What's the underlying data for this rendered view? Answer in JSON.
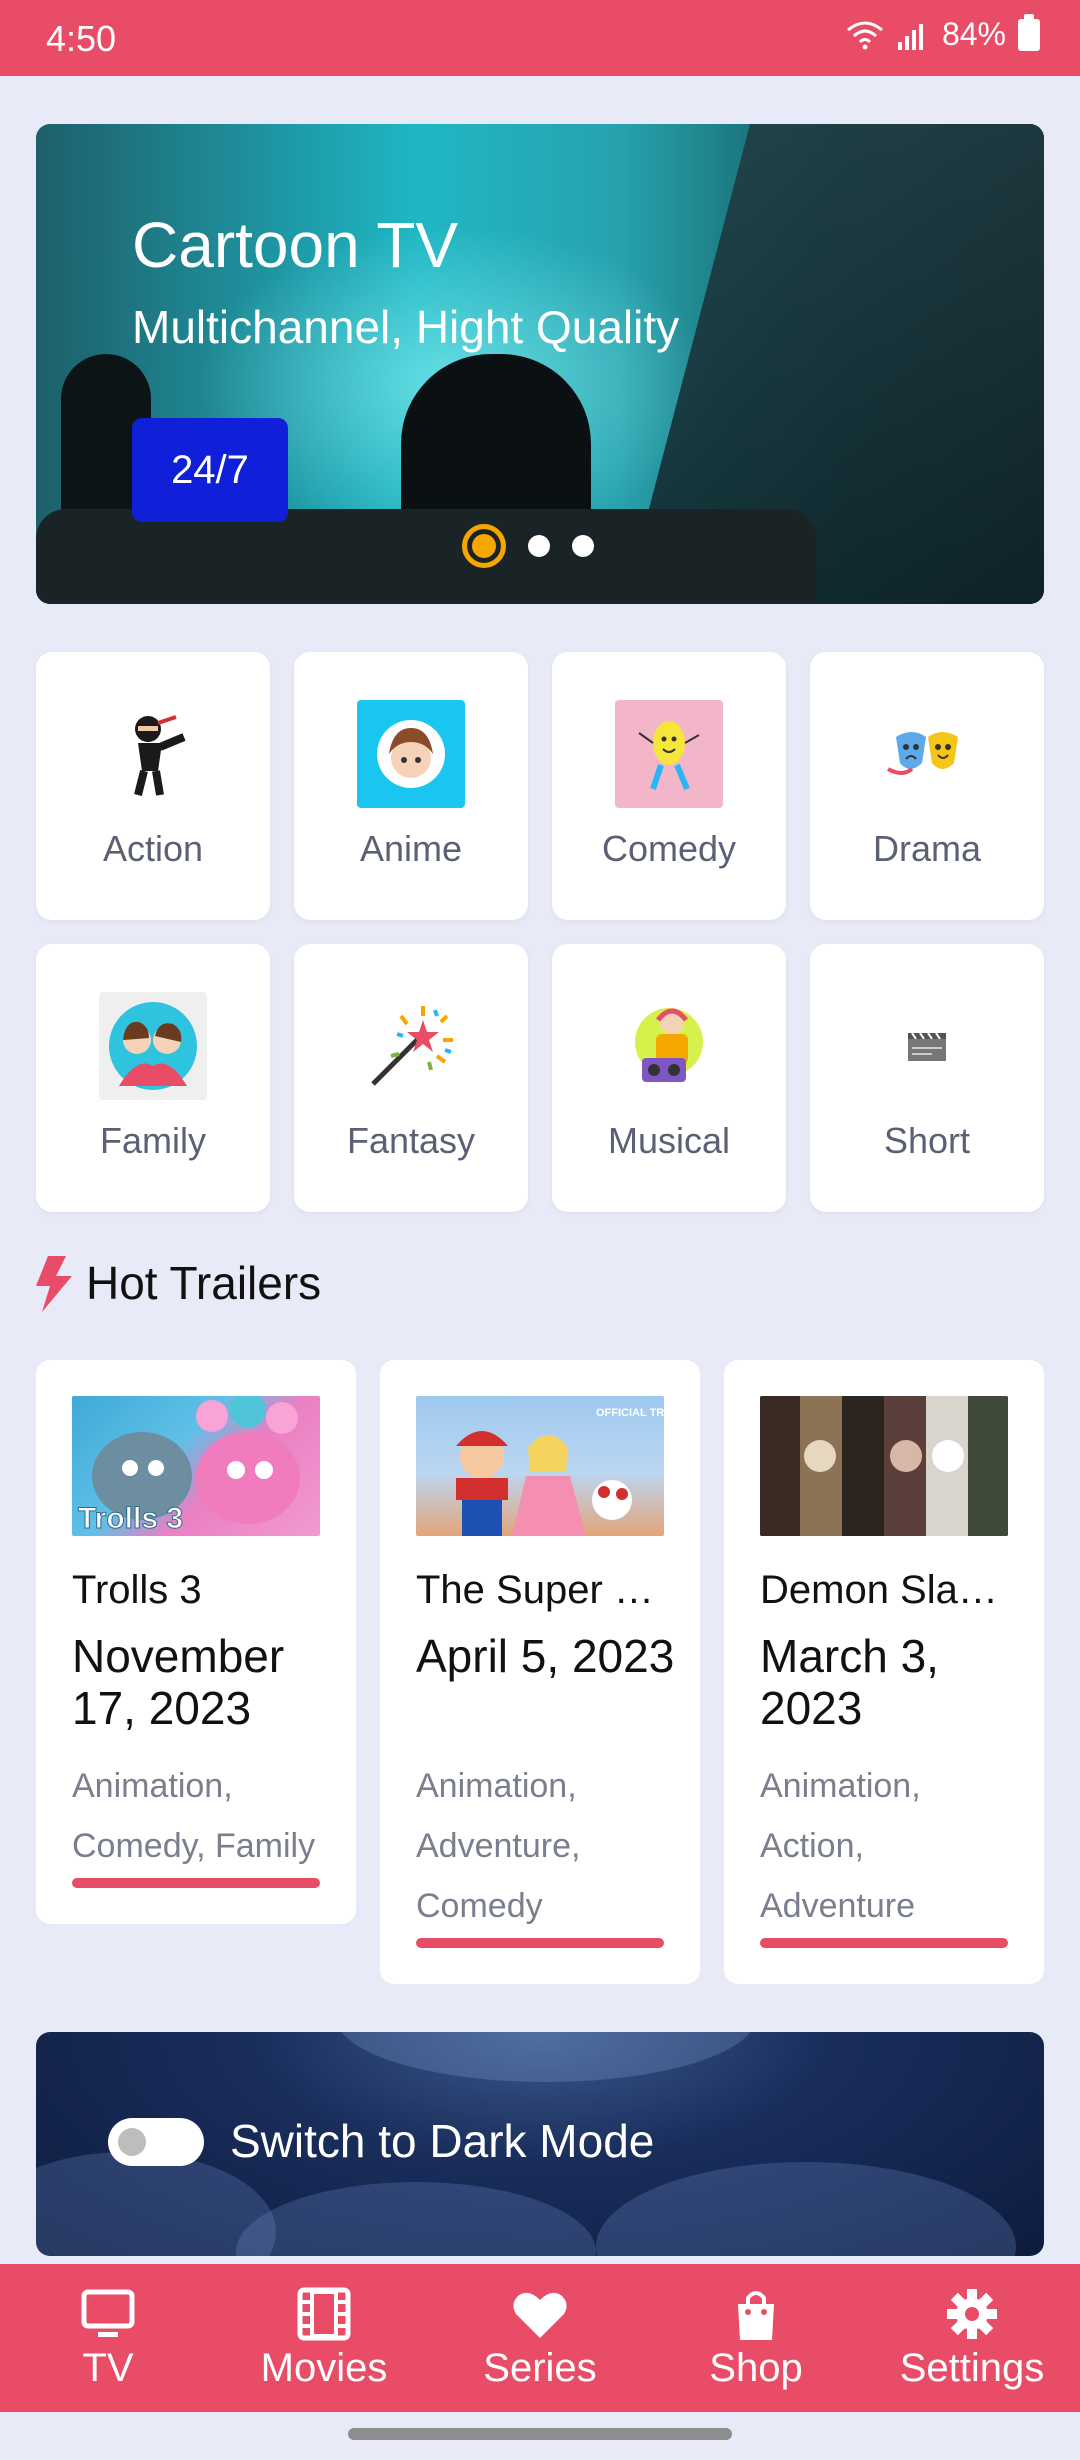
{
  "status_bar": {
    "time": "4:50",
    "battery": "84%"
  },
  "banner": {
    "title": "Cartoon TV",
    "subtitle": "Multichannel, Hight Quality",
    "badge": "24/7",
    "slides": 3,
    "active_slide": 1
  },
  "categories": [
    {
      "label": "Action",
      "icon": "ninja-icon"
    },
    {
      "label": "Anime",
      "icon": "anime-boy-icon"
    },
    {
      "label": "Comedy",
      "icon": "lemon-character-icon"
    },
    {
      "label": "Drama",
      "icon": "theater-masks-icon"
    },
    {
      "label": "Family",
      "icon": "family-icon"
    },
    {
      "label": "Fantasy",
      "icon": "magic-wand-icon"
    },
    {
      "label": "Musical",
      "icon": "musician-icon"
    },
    {
      "label": "Short",
      "icon": "clapperboard-icon"
    }
  ],
  "hot_trailers": {
    "title": "Hot Trailers",
    "items": [
      {
        "title": "Trolls 3",
        "date": "November 17, 2023",
        "genres": "Animation, Comedy, Family",
        "image_text": "Trolls 3"
      },
      {
        "title": "The Super Mario Bros. Movie",
        "title_display": "The Super …",
        "date": "April 5, 2023",
        "genres": "Animation, Adventure, Comedy",
        "image_text": "OFFICIAL TRAILER"
      },
      {
        "title": "Demon Slayer",
        "title_display": "Demon Sla…",
        "date": "March 3, 2023",
        "genres": "Animation, Action, Adventure"
      }
    ]
  },
  "dark_mode": {
    "label": "Switch to Dark Mode",
    "enabled": false
  },
  "bottom_nav": [
    {
      "label": "TV",
      "icon": "tv-icon"
    },
    {
      "label": "Movies",
      "icon": "film-icon"
    },
    {
      "label": "Series",
      "icon": "heart-icon"
    },
    {
      "label": "Shop",
      "icon": "shopping-bag-icon"
    },
    {
      "label": "Settings",
      "icon": "gear-icon"
    }
  ],
  "colors": {
    "accent": "#E84C66",
    "background": "#E9EAF8",
    "badge": "#1020D8",
    "active_dot": "#F5A700"
  }
}
